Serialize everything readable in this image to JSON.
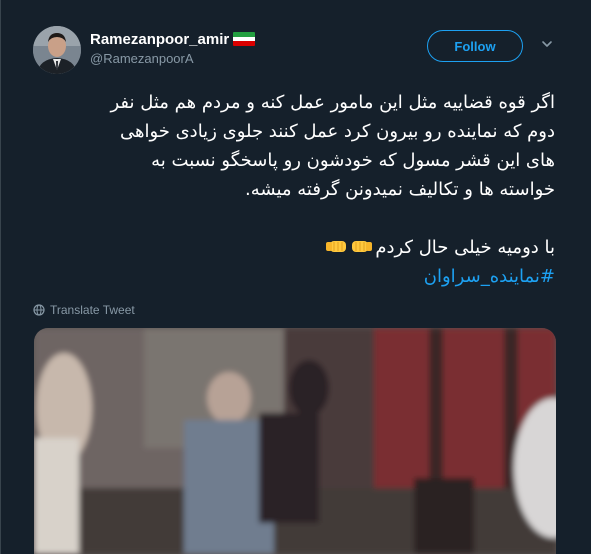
{
  "user": {
    "display_name": "Ramezanpoor_amir",
    "handle": "@RamezanpoorA"
  },
  "follow_label": "Follow",
  "tweet": {
    "lines": [
      "اگر قوه قضاییه مثل این مامور عمل کنه و مردم هم مثل نفر",
      "دوم که نماینده رو بیرون کرد عمل کنند جلوی زیادی خواهی",
      "های این قشر مسول که خودشون رو پاسخگو نسبت به",
      "خواسته ها و تکالیف نمیدونن گرفته میشه."
    ],
    "closing_line": "با دومیه خیلی حال کردم",
    "hashtag": "#نماینده_سراوان"
  },
  "translate_label": "Translate Tweet",
  "icons": {
    "verified_flag": "iran-flag-icon",
    "menu": "chevron-down-icon",
    "translate": "globe-icon",
    "emoji": "fist-bump-icon"
  },
  "colors": {
    "background": "#15202b",
    "accent": "#1da1f2",
    "secondary_text": "#8899a6"
  }
}
